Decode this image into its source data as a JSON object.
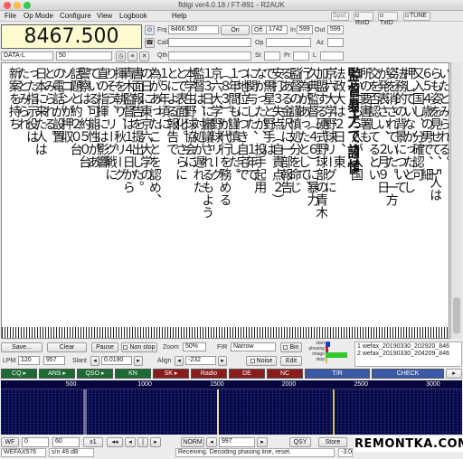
{
  "window": {
    "title": "fldigi ver4.0.18 / FT-891 - R2AUK"
  },
  "menu": {
    "items": [
      "File",
      "Op Mode",
      "Configure",
      "View",
      "Logbook",
      "Help"
    ]
  },
  "mode_lights": {
    "spot": "Spot",
    "rxid": "RxID",
    "txid": "TxID",
    "tune": "TUNE"
  },
  "rig": {
    "frequency": "8467.500",
    "mode": "DATA-L",
    "bandwidth": "50"
  },
  "log": {
    "frq_label": "Frq",
    "frq_value": "8466.503",
    "on_label": "On",
    "off_label": "Off",
    "off_value": "1742",
    "in_label": "In",
    "in_value": "599",
    "out_label": "Out",
    "out_value": "599",
    "call_label": "Call",
    "op_label": "Op",
    "az_label": "Az",
    "qth_label": "Qth",
    "st_label": "St",
    "pr_label": "Pr",
    "l_label": "L"
  },
  "fax": {
    "columns": [
      "いたとみられる。",
      "らも姿を見せて、5人は",
      "６５４歳の男で、細",
      "又入国し、分確認可",
      "押していなかったとし",
      "法務的の背景について",
      "姿を消されていた。一方",
      "が発表さい、２月９日",
      "交を否認してるとい",
      "所の要害署も",
      "ほかにも５人が入国",
      "監督暴力で謹慎",
      "法政大は２日、東",
      "京六大学野球リーグに",
      "加盟する硬式野球部の青木",
      "久典監督（４６）に暴力",
      "行為があったとして、",
      "監督の謹慎処分を命じ",
      "るある金沢に一部報告",
      "安打３失点（自責点２）",
      "で黒星と野手は",
      "なかったが、投手起用",
      "に関与した、１年で",
      "つ地位につき自宅で",
      "１年間も謹慎した。",
      "（８３）が代行を務める",
      "京六大学野球リーグ",
      "１３日に審議されるもよう",
      "監督は、対処が遅れた",
      "本学生野球協会に",
      "とで表面化。さらに",
      "とによる報告で",
      "１５年頃に",
      "為があったことを認め、",
      "の日に東京六大学の",
      "書面報告を提出した。",
      "青木監督は１４日から",
      "揮を執り、秋リーグ",
      "りそう、リーグ戦に",
      "直の指揮には影響",
      "ている可能性があ",
      "警察は、約５０台",
      "話題と約２０台",
      "ソコンが押収",
      "の電話が設置",
      "とみられる。",
      "日本に来た人は",
      "った指示役は",
      "たとみられ",
      "新案を持ち"
    ]
  },
  "controls": {
    "save": "Save...",
    "clear": "Clear",
    "pause": "Pause",
    "nonstop": "Non stop",
    "zoom_label": "Zoom",
    "zoom_value": "50%",
    "fir_label": "FIR",
    "fir_value": "Narrow",
    "bin": "Bin",
    "lpm_label": "LPM",
    "lpm_value": "120",
    "lpm2": "957",
    "slant_label": "Slant",
    "slant_value": "0.0190",
    "align_label": "Align",
    "align_value": "-232",
    "noise": "Noise",
    "edit": "Edit",
    "legend": [
      "start",
      "phasing",
      "image",
      "stop"
    ]
  },
  "files": [
    "1 wefax_20190330_202920_846",
    "2 wefax_20190330_204209_846"
  ],
  "macros": [
    "CQ",
    "ANS",
    "QSO",
    "KN",
    "SK",
    "Radio",
    "DE",
    "NC",
    "T/R",
    "CHECK"
  ],
  "waterfall": {
    "ticks": [
      "500",
      "1000",
      "1500",
      "2000",
      "2500",
      "3000"
    ],
    "peaks_hz": [
      1500,
      2300
    ]
  },
  "wfbar": {
    "wf": "WF",
    "v1": "0",
    "v2": "60",
    "x1": "x1",
    "norm": "NORM",
    "v3": "997",
    "qsy": "QSY",
    "store": "Store"
  },
  "statusbar": {
    "mode": "WEFAX576",
    "sn": "s/n  49 dB",
    "msg": "Receiving. Decoding phasing line, reset.",
    "val": "-3.0"
  },
  "watermark": "REMONTKA.COM",
  "colors": {
    "freq_bg": "#fdfbd0",
    "waterfall_bg": "#04063c",
    "mode_green": "#1c6a34",
    "mode_red": "#8a1c1c",
    "tr": "#3a5aa8"
  }
}
